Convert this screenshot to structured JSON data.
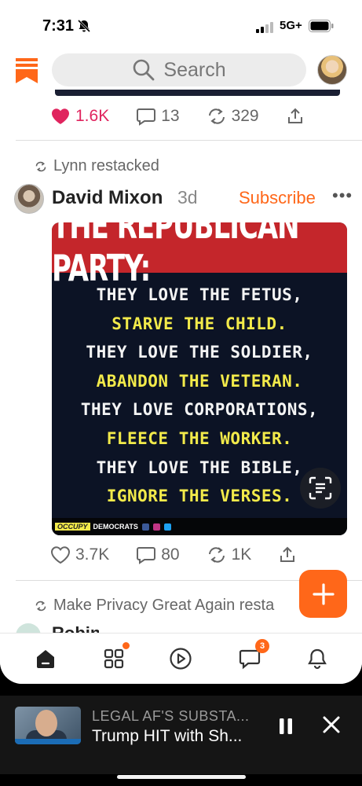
{
  "status_bar": {
    "time": "7:31",
    "network": "5G+"
  },
  "header": {
    "search_placeholder": "Search"
  },
  "post1": {
    "likes": "1.6K",
    "comments": "13",
    "restacks": "329"
  },
  "post2": {
    "restacked_by": "Lynn restacked",
    "author": "David Mixon",
    "age": "3d",
    "subscribe_label": "Subscribe",
    "more_label": "•••",
    "image": {
      "banner": "THE REPUBLICAN PARTY:",
      "lines": [
        {
          "text": "THEY LOVE THE FETUS,",
          "color": "white"
        },
        {
          "text": "STARVE THE CHILD.",
          "color": "yellow"
        },
        {
          "text": "THEY LOVE THE SOLDIER,",
          "color": "white"
        },
        {
          "text": "ABANDON THE VETERAN.",
          "color": "yellow"
        },
        {
          "text": "THEY LOVE CORPORATIONS,",
          "color": "white"
        },
        {
          "text": "FLEECE THE WORKER.",
          "color": "yellow"
        },
        {
          "text": "THEY LOVE THE BIBLE,",
          "color": "white"
        },
        {
          "text": "IGNORE THE VERSES.",
          "color": "yellow"
        }
      ],
      "footer_brand": "OCCUPY",
      "footer_text": "DEMOCRATS"
    },
    "likes": "3.7K",
    "comments": "80",
    "restacks": "1K"
  },
  "post3": {
    "restacked_by": "Make Privacy Great Again resta",
    "author_peek": "Robin"
  },
  "tabbar": {
    "chat_badge": "3"
  },
  "player": {
    "show": "LEGAL AF'S SUBSTA...",
    "title": "Trump HIT with Sh..."
  },
  "colors": {
    "accent": "#ff6719",
    "like": "#e0245e",
    "banner_red": "#c4262b",
    "meme_yellow": "#f2ea4a",
    "meme_bg": "#0c1325"
  }
}
